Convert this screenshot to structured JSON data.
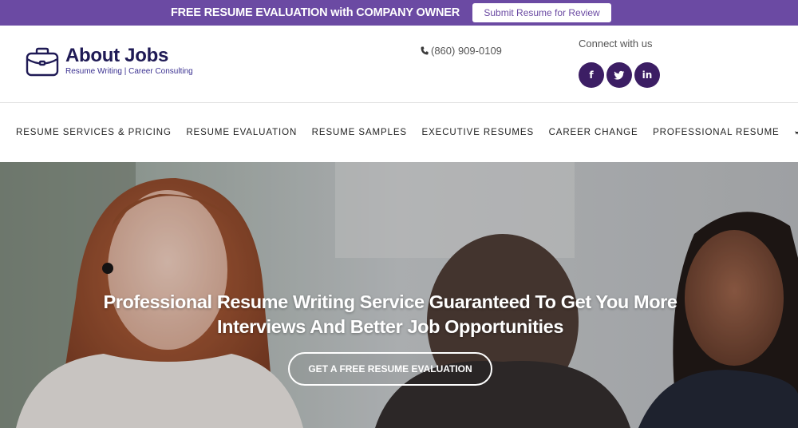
{
  "promo": {
    "text": "FREE RESUME EVALUATION with COMPANY OWNER",
    "button": "Submit Resume for Review"
  },
  "brand": {
    "title": "About Jobs",
    "subtitle": "Resume Writing | Career Consulting",
    "icon": "briefcase-icon",
    "color": "#1f1a55"
  },
  "contact": {
    "phone": "(860) 909-0109",
    "connect_label": "Connect with us",
    "social": [
      {
        "icon": "facebook-icon",
        "label": "f"
      },
      {
        "icon": "twitter-icon",
        "label": ""
      },
      {
        "icon": "linkedin-icon",
        "label": "in"
      }
    ]
  },
  "nav": {
    "items": [
      "RESUME SERVICES & PRICING",
      "RESUME EVALUATION",
      "RESUME SAMPLES",
      "EXECUTIVE RESUMES",
      "CAREER CHANGE",
      "PROFESSIONAL RESUME"
    ],
    "cart_icon": "cart-icon"
  },
  "hero": {
    "title_line1": "Professional Resume Writing Service Guaranteed To Get You More",
    "title_line2": "Interviews And Better Job Opportunities",
    "cta": "GET A FREE RESUME EVALUATION"
  },
  "colors": {
    "promo_bg": "#6b4aa3",
    "social_bg": "#3c1e64"
  }
}
